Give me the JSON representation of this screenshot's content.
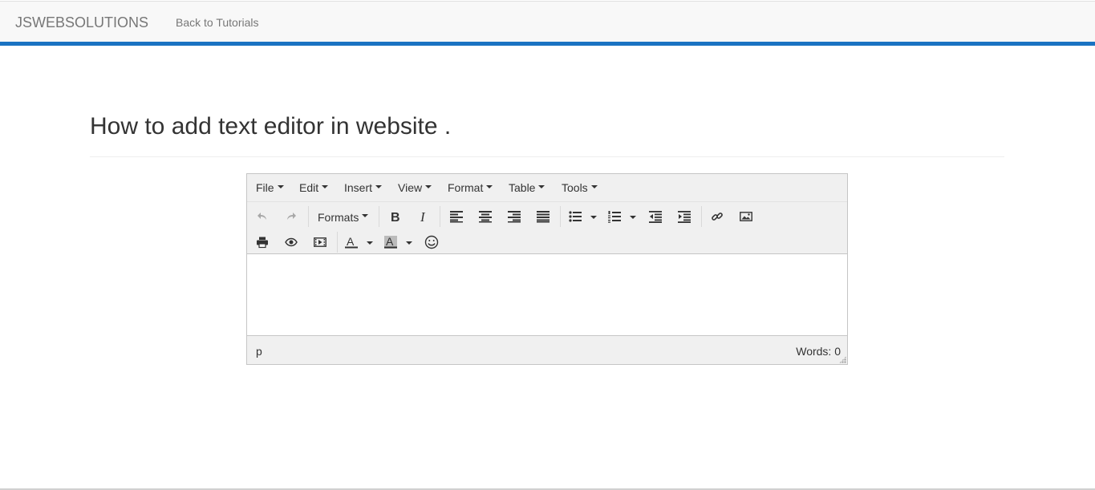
{
  "navbar": {
    "brand": "JSWEBSOLUTIONS",
    "link": "Back to Tutorials",
    "accent_color": "#1a73c2"
  },
  "page": {
    "title": "How to add text editor in website ."
  },
  "editor": {
    "menu": [
      "File",
      "Edit",
      "Insert",
      "View",
      "Format",
      "Table",
      "Tools"
    ],
    "toolbar": {
      "formats_label": "Formats",
      "row1_icons": [
        "undo-icon",
        "redo-icon",
        "formats-dropdown",
        "bold-icon",
        "italic-icon",
        "align-left-icon",
        "align-center-icon",
        "align-right-icon",
        "align-justify-icon",
        "bullet-list-icon",
        "numbered-list-icon",
        "outdent-icon",
        "indent-icon",
        "link-icon",
        "image-icon"
      ],
      "row2_icons": [
        "print-icon",
        "preview-icon",
        "media-icon",
        "text-color-icon",
        "background-color-icon",
        "emoticons-icon"
      ]
    },
    "status": {
      "path": "p",
      "words": "Words: 0"
    }
  }
}
